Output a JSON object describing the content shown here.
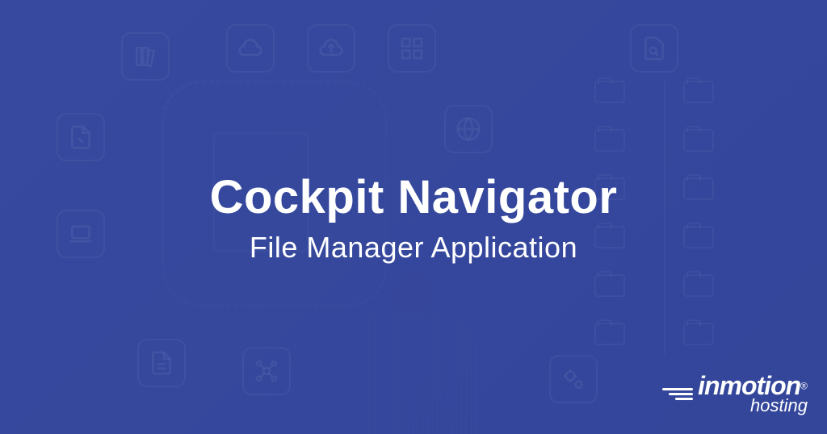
{
  "banner": {
    "headline": "Cockpit Navigator",
    "subheadline": "File Manager Application"
  },
  "logo": {
    "brand": "inmotion",
    "registered": "®",
    "tagline": "hosting"
  }
}
